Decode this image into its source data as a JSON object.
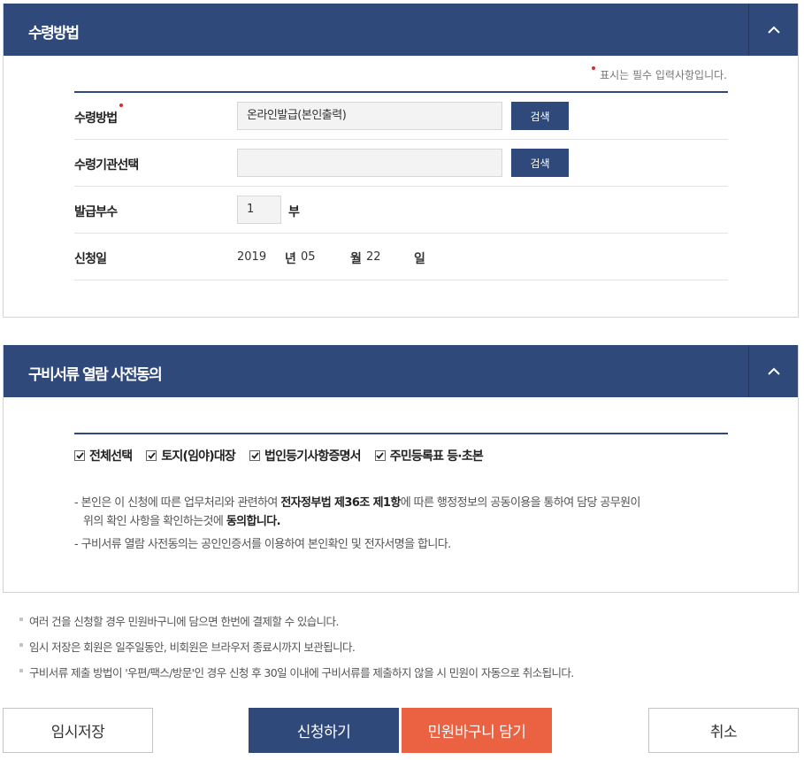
{
  "receipt": {
    "title": "수령방법",
    "required_note": "표시는 필수 입력사항입니다.",
    "rows": {
      "method": {
        "label": "수령방법",
        "value": "온라인발급(본인출력)",
        "button": "검색"
      },
      "agency": {
        "label": "수령기관선택",
        "value": "",
        "button": "검색"
      },
      "copies": {
        "label": "발급부수",
        "value": "1",
        "unit": "부"
      },
      "date": {
        "label": "신청일",
        "year": "2019",
        "year_unit": "년",
        "month": "05",
        "month_unit": "월",
        "day": "22",
        "day_unit": "일"
      }
    }
  },
  "consent": {
    "title": "구비서류 열람 사전동의",
    "checkboxes": [
      {
        "label": "전체선택",
        "checked": true
      },
      {
        "label": "토지(임야)대장",
        "checked": true
      },
      {
        "label": "법인등기사항증명서",
        "checked": true
      },
      {
        "label": "주민등록표 등·초본",
        "checked": true
      }
    ],
    "notice1_a": "- 본인은 이 신청에 따른 업무처리와 관련하여 ",
    "notice1_b": "전자정부법 제36조 제1항",
    "notice1_c": "에 따른 행정정보의 공동이용을 통하여 담당 공무원이",
    "notice1_d": "위의 확인 사항을 확인하는것에 ",
    "notice1_e": "동의합니다.",
    "notice2": "- 구비서류 열람 사전동의는 공인인증서를 이용하여 본인확인 및 전자서명을 합니다."
  },
  "info": [
    "여러 건을 신청할 경우 민원바구니에 담으면 한번에 결제할 수 있습니다.",
    "임시 저장은 회원은 일주일동안, 비회원은 브라우저 종료시까지 보관됩니다.",
    "구비서류 제출 방법이 '우편/팩스/방문'인 경우 신청 후 30일 이내에 구비서류를 제출하지 않을 시 민원이 자동으로 취소됩니다."
  ],
  "buttons": {
    "temp_save": "임시저장",
    "apply": "신청하기",
    "cart": "민원바구니 담기",
    "cancel": "취소"
  },
  "colors": {
    "header": "#30497b",
    "accent_orange": "#ea6242",
    "required_dot": "#e0262d"
  },
  "icons": {
    "collapse": "chevron-up-icon",
    "checkbox": "checkmark-icon"
  }
}
